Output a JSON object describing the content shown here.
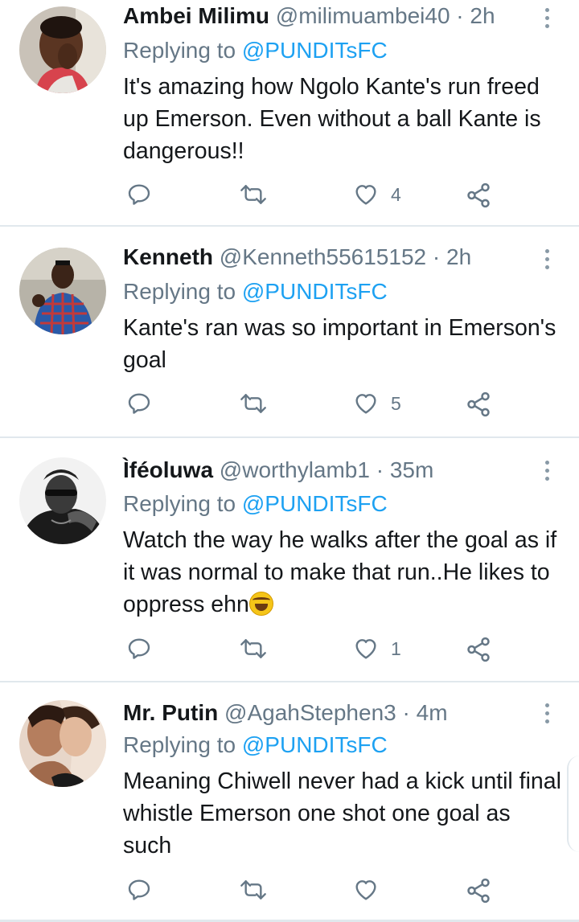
{
  "tweets": [
    {
      "name": "Ambei Milimu",
      "handle": "@milimuambei40",
      "separator": "·",
      "time": "2h",
      "replying_label": "Replying to",
      "replying_to": "@PUNDITsFC",
      "text": "It's amazing how Ngolo Kante's run freed up Emerson. Even without a ball Kante is dangerous!!",
      "likes": "4"
    },
    {
      "name": "Kenneth",
      "handle": "@Kenneth55615152",
      "separator": "·",
      "time": "2h",
      "replying_label": "Replying to",
      "replying_to": "@PUNDITsFC",
      "text": "Kante's ran was so important in Emerson's goal",
      "likes": "5"
    },
    {
      "name": "Ìféoluwa",
      "handle": "@worthylamb1",
      "separator": "·",
      "time": "35m",
      "replying_label": "Replying to",
      "replying_to": "@PUNDITsFC",
      "text": "Watch the way he walks after the goal as if it was normal to make that run..He likes to oppress ehn",
      "emoji": "rolling-on-floor-laughing",
      "likes": "1"
    },
    {
      "name": "Mr. Putin",
      "handle": "@AgahStephen3",
      "separator": "·",
      "time": "4m",
      "replying_label": "Replying to",
      "replying_to": "@PUNDITsFC",
      "text": "Meaning Chiwell never had a kick until final whistle Emerson one shot one goal as such",
      "likes": ""
    }
  ],
  "icons": {
    "reply": "reply-icon",
    "retweet": "retweet-icon",
    "like": "heart-icon",
    "share": "share-icon",
    "more": "more-vertical-icon"
  },
  "colors": {
    "link": "#1da1f2",
    "secondary_text": "#657786",
    "icon": "#657786",
    "divider": "#e1e8ed"
  }
}
